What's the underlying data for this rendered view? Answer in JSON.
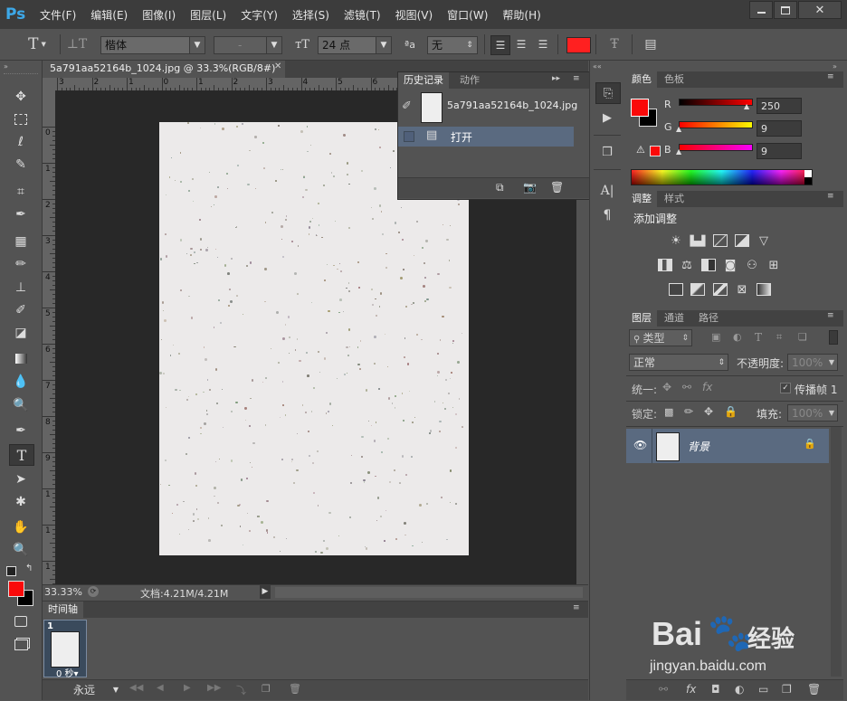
{
  "app": {
    "logo": "Ps"
  },
  "menu": [
    "文件(F)",
    "编辑(E)",
    "图像(I)",
    "图层(L)",
    "文字(Y)",
    "选择(S)",
    "滤镜(T)",
    "视图(V)",
    "窗口(W)",
    "帮助(H)"
  ],
  "options": {
    "tool_glyph": "T",
    "font_family": "楷体",
    "font_style": "-",
    "font_size": "24 点",
    "aa_label": "ªa",
    "antialias": "无",
    "text_color": "#ff2020"
  },
  "document": {
    "tab_title": "5a791aa52164b_1024.jpg @ 33.3%(RGB/8#)",
    "zoom": "33.33%",
    "doc_info": "文档:4.21M/4.21M",
    "ruler_h": [
      "3",
      "2",
      "1",
      "0",
      "1",
      "2",
      "3",
      "4",
      "5",
      "6",
      "7",
      "8",
      "9"
    ],
    "ruler_v": [
      "0",
      "1",
      "2",
      "3",
      "4",
      "5",
      "6",
      "7",
      "8",
      "9",
      "1",
      "1",
      "1"
    ]
  },
  "history": {
    "tabs": [
      "历史记录",
      "动作"
    ],
    "snapshot_name": "5a791aa52164b_1024.jpg",
    "items": [
      "打开"
    ]
  },
  "color": {
    "tabs": [
      "颜色",
      "色板"
    ],
    "r_label": "R",
    "g_label": "G",
    "b_label": "B",
    "r": "250",
    "g": "9",
    "b": "9",
    "fg": "#fa0909"
  },
  "adjustments": {
    "tabs": [
      "调整",
      "样式"
    ],
    "title": "添加调整"
  },
  "layers": {
    "tabs": [
      "图层",
      "通道",
      "路径"
    ],
    "filter_kind": "类型",
    "blend_mode": "正常",
    "opacity_label": "不透明度:",
    "opacity_value": "100%",
    "unify_label": "统一:",
    "propagate_label": "传播帧 1",
    "lock_label": "锁定:",
    "fill_label": "填充:",
    "fill_value": "100%",
    "layer_name": "背景"
  },
  "timeline": {
    "tab": "时间轴",
    "frame_number": "1",
    "frame_delay": "0 秒▾",
    "loop": "永远"
  },
  "watermark": {
    "brand": "Bai",
    "brand2": "经验",
    "url": "jingyan.baidu.com"
  }
}
